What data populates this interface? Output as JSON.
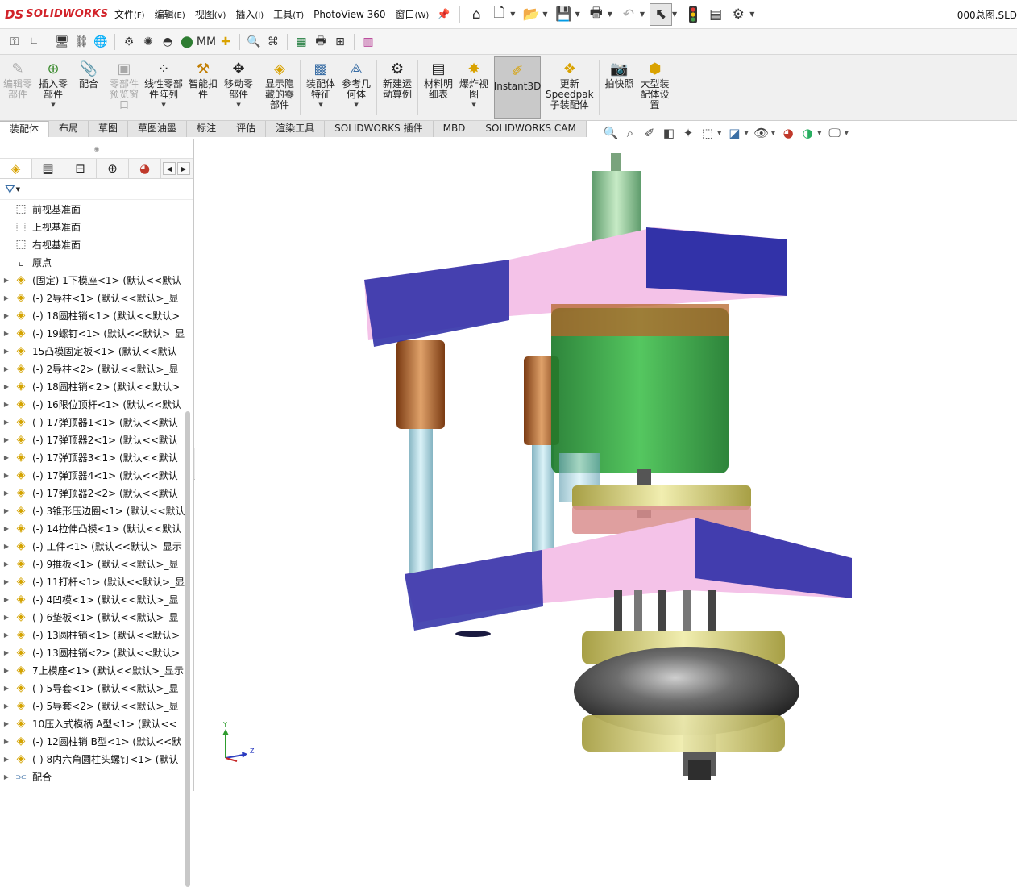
{
  "app": {
    "brand_ds": "DS",
    "brand_name": "SOLIDWORKS",
    "document_title": "000总图.SLD"
  },
  "menu": [
    {
      "label": "文件",
      "accel": "(F)"
    },
    {
      "label": "编辑",
      "accel": "(E)"
    },
    {
      "label": "视图",
      "accel": "(V)"
    },
    {
      "label": "插入",
      "accel": "(I)"
    },
    {
      "label": "工具",
      "accel": "(T)"
    },
    {
      "label": "PhotoView 360",
      "accel": ""
    },
    {
      "label": "窗口",
      "accel": "(W)"
    }
  ],
  "command_manager": [
    {
      "label": "编辑零\n部件",
      "icon": "edit-component-icon",
      "disabled": true,
      "caret": false
    },
    {
      "label": "插入零\n部件",
      "icon": "insert-component-icon",
      "disabled": false,
      "caret": true
    },
    {
      "label": "配合",
      "icon": "mate-icon",
      "disabled": false,
      "caret": false
    },
    {
      "label": "零部件\n预览窗\n口",
      "icon": "component-preview-icon",
      "disabled": true,
      "caret": false
    },
    {
      "label": "线性零部\n件阵列",
      "icon": "linear-pattern-icon",
      "disabled": false,
      "caret": true
    },
    {
      "label": "智能扣\n件",
      "icon": "smart-fastener-icon",
      "disabled": false,
      "caret": false
    },
    {
      "label": "移动零\n部件",
      "icon": "move-component-icon",
      "disabled": false,
      "caret": true
    },
    {
      "label": "显示隐\n藏的零\n部件",
      "icon": "show-hidden-icon",
      "disabled": false,
      "caret": false
    },
    {
      "label": "装配体\n特征",
      "icon": "assembly-feature-icon",
      "disabled": false,
      "caret": true
    },
    {
      "label": "参考几\n何体",
      "icon": "reference-geometry-icon",
      "disabled": false,
      "caret": true
    },
    {
      "label": "新建运\n动算例",
      "icon": "motion-study-icon",
      "disabled": false,
      "caret": false
    },
    {
      "label": "材料明\n细表",
      "icon": "bom-icon",
      "disabled": false,
      "caret": false
    },
    {
      "label": "爆炸视\n图",
      "icon": "exploded-view-icon",
      "disabled": false,
      "caret": true
    },
    {
      "label": "Instant3D",
      "icon": "instant3d-icon",
      "disabled": false,
      "caret": false,
      "active": true
    },
    {
      "label": "更新\nSpeedpak\n子装配体",
      "icon": "speedpak-icon",
      "disabled": false,
      "caret": false
    },
    {
      "label": "拍快照",
      "icon": "snapshot-icon",
      "disabled": false,
      "caret": false
    },
    {
      "label": "大型装\n配体设\n置",
      "icon": "large-assembly-icon",
      "disabled": false,
      "caret": false
    }
  ],
  "tabs": [
    "装配体",
    "布局",
    "草图",
    "草图油墨",
    "标注",
    "评估",
    "渲染工具",
    "SOLIDWORKS 插件",
    "MBD",
    "SOLIDWORKS CAM"
  ],
  "tree": {
    "planes": [
      {
        "label": "前视基准面"
      },
      {
        "label": "上视基准面"
      },
      {
        "label": "右视基准面"
      },
      {
        "label": "原点"
      }
    ],
    "components": [
      "(固定) 1下模座<1> (默认<<默认",
      "(-) 2导柱<1> (默认<<默认>_显",
      "(-) 18圆柱销<1> (默认<<默认>",
      "(-) 19螺钉<1> (默认<<默认>_显",
      "15凸模固定板<1> (默认<<默认",
      "(-) 2导柱<2> (默认<<默认>_显",
      "(-) 18圆柱销<2> (默认<<默认>",
      "(-) 16限位顶杆<1> (默认<<默认",
      "(-) 17弹顶器1<1> (默认<<默认",
      "(-) 17弹顶器2<1> (默认<<默认",
      "(-) 17弹顶器3<1> (默认<<默认",
      "(-) 17弹顶器4<1> (默认<<默认",
      "(-) 17弹顶器2<2> (默认<<默认",
      "(-) 3锥形压边圈<1> (默认<<默认",
      "(-) 14拉伸凸模<1> (默认<<默认",
      "(-) 工件<1> (默认<<默认>_显示",
      "(-) 9推板<1> (默认<<默认>_显",
      "(-) 11打杆<1> (默认<<默认>_显",
      "(-) 4凹模<1> (默认<<默认>_显",
      "(-) 6垫板<1> (默认<<默认>_显",
      "(-) 13圆柱销<1> (默认<<默认>",
      "(-) 13圆柱销<2> (默认<<默认>",
      "7上模座<1> (默认<<默认>_显示",
      "(-) 5导套<1> (默认<<默认>_显",
      "(-) 5导套<2> (默认<<默认>_显",
      "10压入式模柄 A型<1> (默认<<",
      "(-) 12圆柱销 B型<1> (默认<<默",
      "(-) 8内六角圆柱头螺钉<1> (默认"
    ],
    "mates_label": "配合"
  },
  "triad": {
    "x": "",
    "y": "Y",
    "z": "Z"
  },
  "colors": {
    "brand": "#d2232a",
    "plate_pink": "#f4c2e8",
    "plate_blue": "#3232a8",
    "gear_green": "#2fa83a",
    "bronze": "#b5652b",
    "lightgreen": "#9dc79a",
    "olive": "#d6d38a"
  }
}
